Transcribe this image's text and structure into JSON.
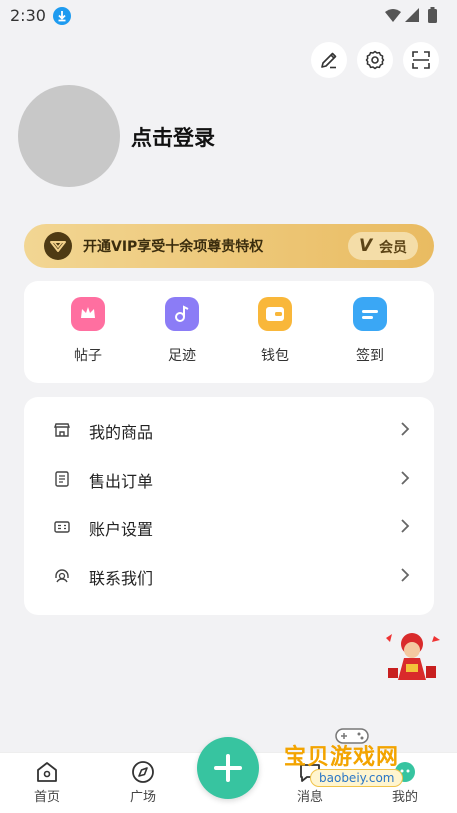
{
  "status_bar": {
    "time": "2:30"
  },
  "profile": {
    "login_label": "点击登录"
  },
  "vip": {
    "text": "开通VIP享受十余项尊贵特权",
    "badge_mark": "V",
    "badge_label": "会员"
  },
  "quick_actions": [
    {
      "label": "帖子",
      "icon": "crown-post-icon",
      "color": "#ff6fa0"
    },
    {
      "label": "足迹",
      "icon": "footprint-icon",
      "color": "#8b7cf6"
    },
    {
      "label": "钱包",
      "icon": "wallet-icon",
      "color": "#f9b73a"
    },
    {
      "label": "签到",
      "icon": "checkin-icon",
      "color": "#3aa7f5"
    }
  ],
  "menu": [
    {
      "label": "我的商品",
      "icon": "store-icon"
    },
    {
      "label": "售出订单",
      "icon": "order-icon"
    },
    {
      "label": "账户设置",
      "icon": "account-card-icon"
    },
    {
      "label": "联系我们",
      "icon": "headset-icon"
    }
  ],
  "tabbar": {
    "items": [
      {
        "label": "首页",
        "icon": "home-icon"
      },
      {
        "label": "广场",
        "icon": "compass-icon"
      },
      {
        "label": "消息",
        "icon": "message-icon"
      },
      {
        "label": "我的",
        "icon": "user-icon"
      }
    ],
    "fab_icon": "plus-icon",
    "accent": "#37c4a0"
  },
  "watermark": {
    "text": "宝贝游戏网",
    "url": "baobeiy.com"
  }
}
